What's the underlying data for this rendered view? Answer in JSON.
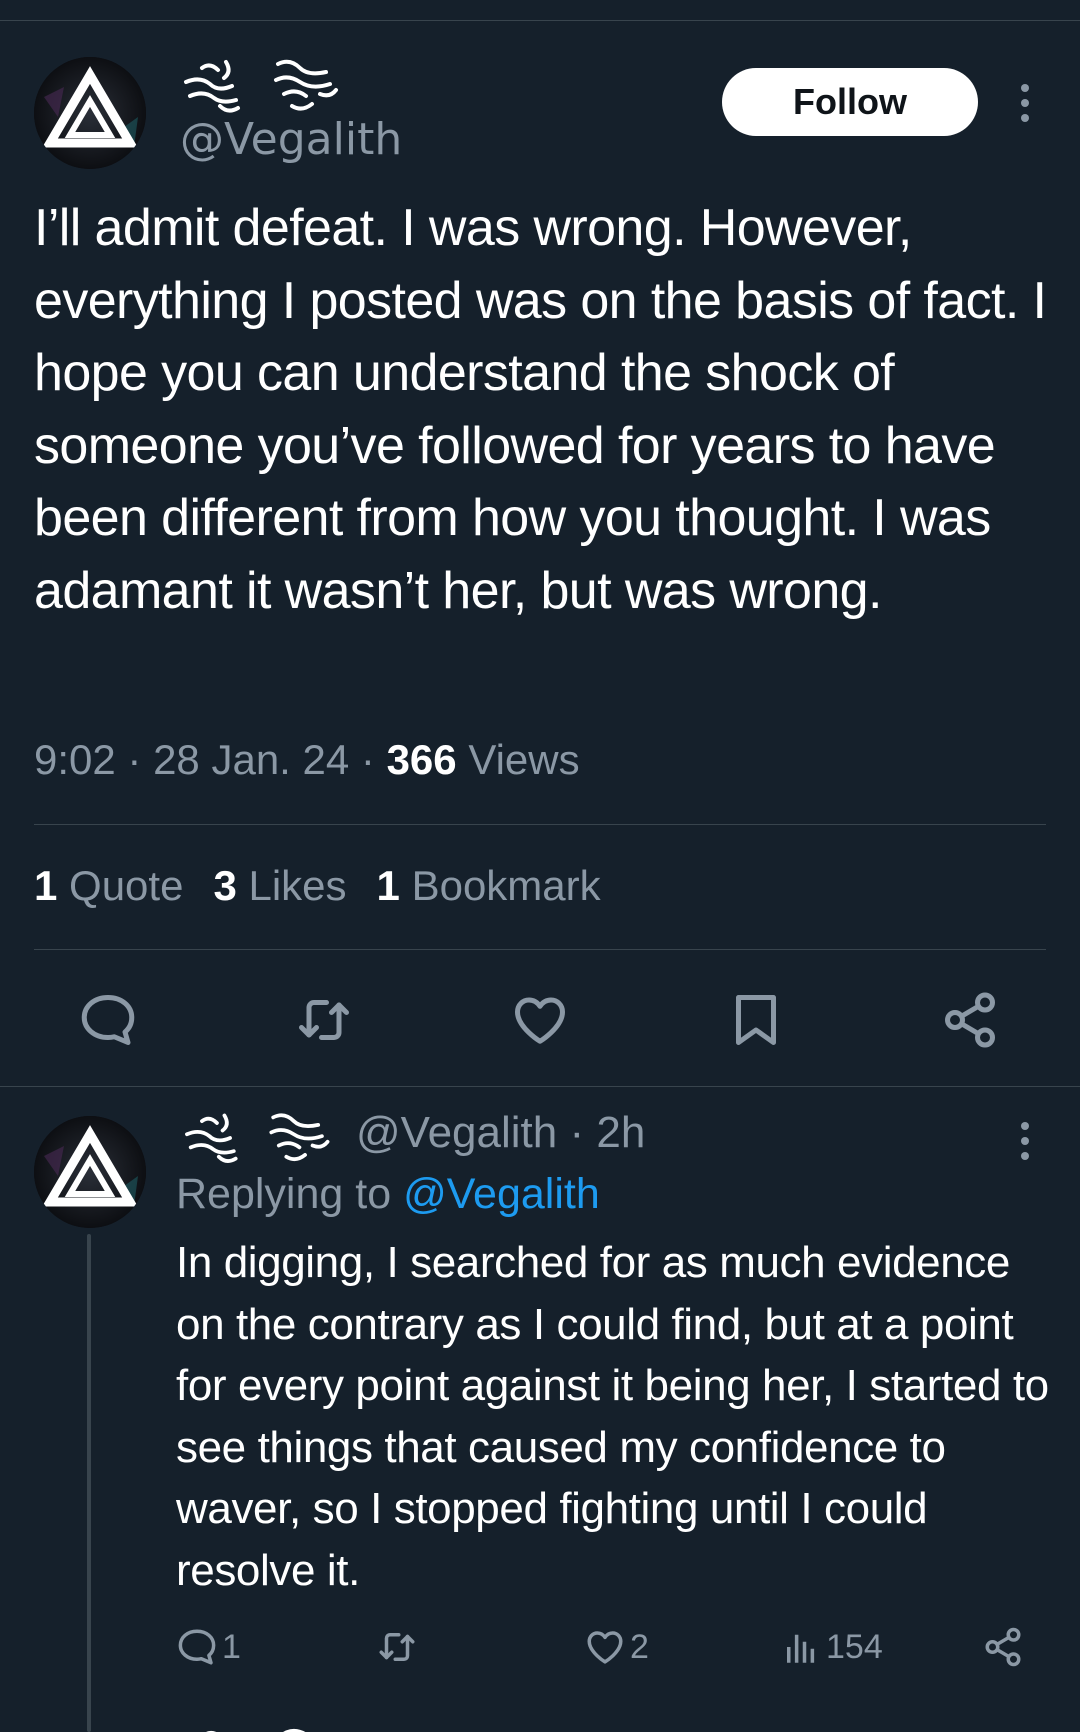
{
  "main_tweet": {
    "handle": "@Vegalith",
    "follow_label": "Follow",
    "text": "I’ll admit defeat. I was wrong. However, everything I posted was on the basis of fact. I hope you can understand the shock of someone you’ve followed for years to have been different from how you thought. I was adamant it wasn’t her, but was wrong.",
    "time": "9:02",
    "date": "28 Jan. 24",
    "views_count": "366",
    "views_label": "Views",
    "stats": {
      "quotes_count": "1",
      "quotes_label": "Quote",
      "likes_count": "3",
      "likes_label": "Likes",
      "bookmarks_count": "1",
      "bookmarks_label": "Bookmark"
    },
    "actions": [
      "reply-icon",
      "retweet-icon",
      "like-icon",
      "bookmark-icon",
      "share-icon"
    ]
  },
  "reply_tweet": {
    "handle": "@Vegalith",
    "age": "2h",
    "replying_to_label": "Replying to",
    "replying_to_handle": "@Vegalith",
    "text": "In digging, I searched for as much evidence on the contrary as I could find, but at a point for every point against it being her, I started to see things that caused my confidence to waver, so I stopped fighting until I could resolve it.",
    "replies": "1",
    "likes": "2",
    "views": "154"
  },
  "colors": {
    "background": "#15202b",
    "muted": "#8b98a5",
    "link": "#1d9bf0",
    "divider": "#38444d"
  }
}
